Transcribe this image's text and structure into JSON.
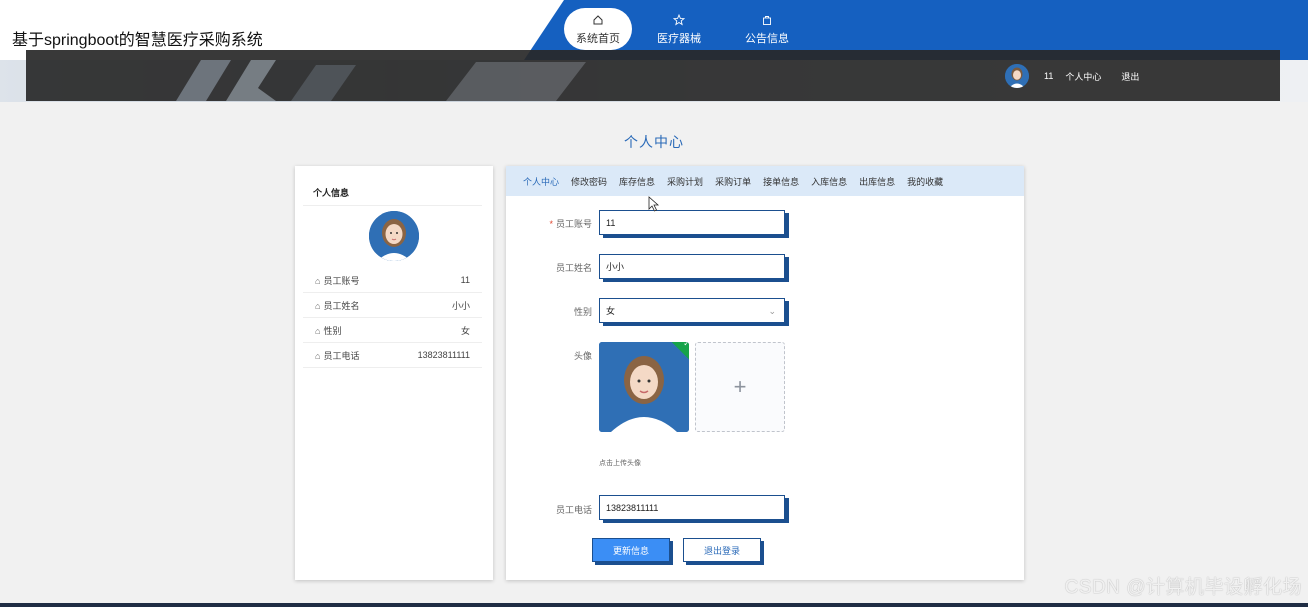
{
  "header": {
    "site_title": "基于springboot的智慧医疗采购系统",
    "nav": [
      {
        "label": "系统首页",
        "icon": "home-icon",
        "active": true
      },
      {
        "label": "医疗器械",
        "icon": "star-icon",
        "active": false
      },
      {
        "label": "公告信息",
        "icon": "bag-icon",
        "active": false
      }
    ],
    "user": {
      "name": "11",
      "center_label": "个人中心",
      "logout_label": "退出"
    }
  },
  "page_title": "个人中心",
  "profile_card": {
    "title": "个人信息",
    "rows": [
      {
        "label": "员工账号",
        "value": "11"
      },
      {
        "label": "员工姓名",
        "value": "小小"
      },
      {
        "label": "性别",
        "value": "女"
      },
      {
        "label": "员工电话",
        "value": "13823811111"
      }
    ]
  },
  "tabs": [
    "个人中心",
    "修改密码",
    "库存信息",
    "采购计划",
    "采购订单",
    "接单信息",
    "入库信息",
    "出库信息",
    "我的收藏"
  ],
  "form": {
    "account_label": "员工账号",
    "account_value": "11",
    "name_label": "员工姓名",
    "name_value": "小小",
    "gender_label": "性别",
    "gender_value": "女",
    "avatar_label": "头像",
    "upload_hint": "点击上传头像",
    "phone_label": "员工电话",
    "phone_value": "13823811111",
    "update_button": "更新信息",
    "logout_button": "退出登录"
  },
  "watermark": "CSDN @计算机毕设孵化场",
  "colors": {
    "nav_blue": "#1560c0",
    "accent": "#2a6ab8",
    "primary_button": "#3b8ef5",
    "upload_success": "#16a34a"
  }
}
